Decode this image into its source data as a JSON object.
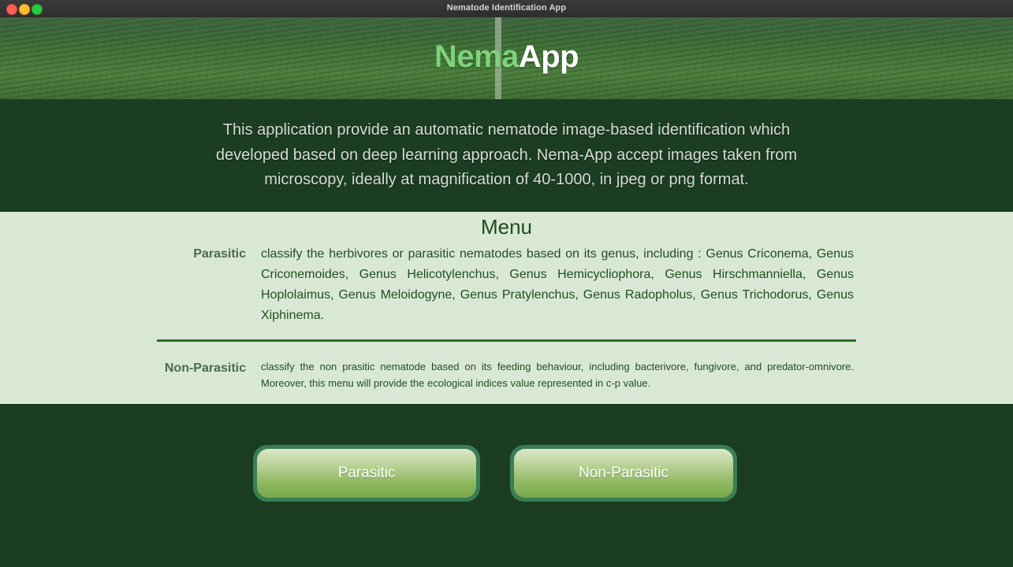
{
  "window": {
    "title": "Nematode Identification App"
  },
  "header": {
    "brand_part1": "Nema",
    "brand_part2": "App",
    "brand_colors": {
      "part1": "#7ed27a",
      "part2": "#ffffff"
    }
  },
  "intro": {
    "text": "This application provide an automatic nematode image-based identification which developed based on deep learning approach. Nema-App accept images taken from microscopy, ideally at magnification of 40-1000, in jpeg or png format."
  },
  "menu": {
    "title": "Menu",
    "items": [
      {
        "label": "Parasitic",
        "description": "classify the herbivores or parasitic nematodes based on its genus, including : Genus Criconema, Genus Criconemoides, Genus Helicotylenchus, Genus Hemicycliophora, Genus Hirschmanniella, Genus Hoplolaimus, Genus Meloidogyne, Genus Pratylenchus, Genus Radopholus, Genus Trichodorus, Genus Xiphinema."
      },
      {
        "label": "Non-Parasitic",
        "description": "classify the non prasitic nematode based on its feeding behaviour, including bacterivore, fungivore, and predator-omnivore. Moreover, this menu will provide the ecological indices value represented in c-p value."
      }
    ]
  },
  "actions": {
    "parasitic_label": "Parasitic",
    "nonparasitic_label": "Non-Parasitic"
  },
  "colors": {
    "background": "#1a3d22",
    "menu_background": "#d9e8d5",
    "accent": "#2a6e24",
    "button_border": "#3a7d55"
  }
}
